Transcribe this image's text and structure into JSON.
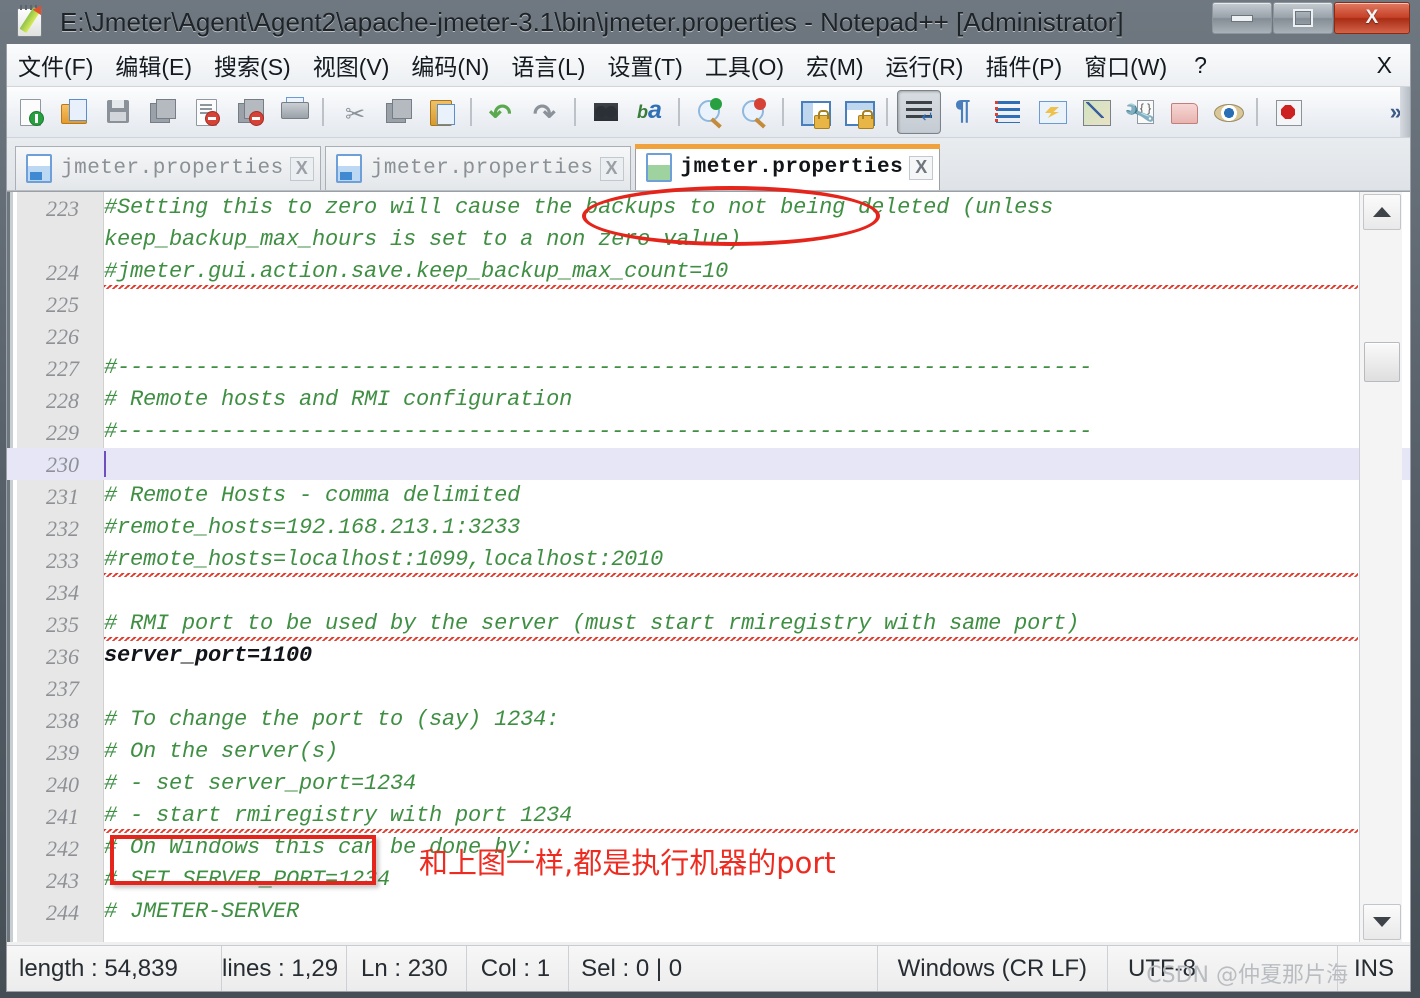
{
  "window": {
    "title": "E:\\Jmeter\\Agent\\Agent2\\apache-jmeter-3.1\\bin\\jmeter.properties - Notepad++ [Administrator]",
    "minimize_label": "",
    "maximize_label": "",
    "close_label": "X",
    "app_icon": "notepadpp-icon"
  },
  "menu": {
    "items": [
      {
        "label": "文件(F)",
        "name": "menu-file"
      },
      {
        "label": "编辑(E)",
        "name": "menu-edit"
      },
      {
        "label": "搜索(S)",
        "name": "menu-search"
      },
      {
        "label": "视图(V)",
        "name": "menu-view"
      },
      {
        "label": "编码(N)",
        "name": "menu-encoding"
      },
      {
        "label": "语言(L)",
        "name": "menu-language"
      },
      {
        "label": "设置(T)",
        "name": "menu-settings"
      },
      {
        "label": "工具(O)",
        "name": "menu-tools"
      },
      {
        "label": "宏(M)",
        "name": "menu-macro"
      },
      {
        "label": "运行(R)",
        "name": "menu-run"
      },
      {
        "label": "插件(P)",
        "name": "menu-plugins"
      },
      {
        "label": "窗口(W)",
        "name": "menu-window"
      },
      {
        "label": "?",
        "name": "menu-help"
      }
    ],
    "close_document": "X"
  },
  "toolbar": {
    "icons": [
      "new-file-icon",
      "open-file-icon",
      "save-icon",
      "save-all-icon",
      "close-file-icon",
      "close-all-icon",
      "print-icon",
      "cut-icon",
      "copy-icon",
      "paste-icon",
      "undo-icon",
      "redo-icon",
      "find-icon",
      "replace-icon",
      "zoom-in-icon",
      "zoom-out-icon",
      "sync-vertical-scroll-icon",
      "sync-horizontal-scroll-icon",
      "word-wrap-icon",
      "show-all-characters-icon",
      "indent-guide-icon",
      "user-defined-language-icon",
      "document-map-icon",
      "function-list-icon",
      "folder-as-workspace-icon",
      "monitoring-icon",
      "record-macro-icon"
    ],
    "overflow_label": "»"
  },
  "tabs": [
    {
      "label": "jmeter.properties",
      "active": false,
      "close": "X",
      "icon": "saved-doc-icon"
    },
    {
      "label": "jmeter.properties",
      "active": false,
      "close": "X",
      "icon": "saved-doc-icon"
    },
    {
      "label": "jmeter.properties",
      "active": true,
      "close": "X",
      "icon": "modified-doc-icon"
    }
  ],
  "editor": {
    "lines": [
      {
        "num": "223",
        "text": "#Setting this to zero will cause the backups to not being deleted (unless",
        "type": "comment"
      },
      {
        "num": "",
        "text": "keep_backup_max_hours is set to a non zero value)",
        "type": "comment"
      },
      {
        "num": "224",
        "text": "#jmeter.gui.action.save.keep_backup_max_count=10",
        "type": "comment"
      },
      {
        "num": "225",
        "text": "",
        "type": "comment"
      },
      {
        "num": "226",
        "text": "",
        "type": "comment"
      },
      {
        "num": "227",
        "text": "#---------------------------------------------------------------------------",
        "type": "comment"
      },
      {
        "num": "228",
        "text": "# Remote hosts and RMI configuration",
        "type": "comment"
      },
      {
        "num": "229",
        "text": "#---------------------------------------------------------------------------",
        "type": "comment"
      },
      {
        "num": "230",
        "text": "",
        "type": "current"
      },
      {
        "num": "231",
        "text": "# Remote Hosts - comma delimited",
        "type": "comment"
      },
      {
        "num": "232",
        "text": "#remote_hosts=192.168.213.1:3233",
        "type": "comment"
      },
      {
        "num": "233",
        "text": "#remote_hosts=localhost:1099,localhost:2010",
        "type": "comment"
      },
      {
        "num": "234",
        "text": "",
        "type": "comment"
      },
      {
        "num": "235",
        "text": "# RMI port to be used by the server (must start rmiregistry with same port)",
        "type": "comment"
      },
      {
        "num": "236",
        "text": "server_port=1100",
        "type": "property"
      },
      {
        "num": "237",
        "text": "",
        "type": "comment"
      },
      {
        "num": "238",
        "text": "# To change the port to (say) 1234:",
        "type": "comment"
      },
      {
        "num": "239",
        "text": "# On the server(s)",
        "type": "comment"
      },
      {
        "num": "240",
        "text": "# - set server_port=1234",
        "type": "comment"
      },
      {
        "num": "241",
        "text": "# - start rmiregistry with port 1234",
        "type": "comment"
      },
      {
        "num": "242",
        "text": "# On Windows this can be done by:",
        "type": "comment"
      },
      {
        "num": "243",
        "text": "# SET SERVER_PORT=1234",
        "type": "comment"
      },
      {
        "num": "244",
        "text": "# JMETER-SERVER",
        "type": "comment"
      }
    ]
  },
  "annotations": {
    "note_text": "和上图一样,都是执行机器的port",
    "note_color": "#ee2b20",
    "highlight_color": "#e5251b"
  },
  "statusbar": {
    "length": "length : 54,839",
    "lines": "lines : 1,29",
    "ln": "Ln : 230",
    "col": "Col : 1",
    "sel": "Sel : 0 | 0",
    "eol": "Windows (CR LF)",
    "encoding": "UTF-8",
    "insert_mode": "INS"
  },
  "watermark": "CSDN @仲夏那片海",
  "colors": {
    "comment_green": "#3f8f43",
    "property_black": "#111418",
    "current_line": "#e6e6f7",
    "active_tab_bar": "#f0a23c",
    "caret": "#6d4fbf"
  }
}
